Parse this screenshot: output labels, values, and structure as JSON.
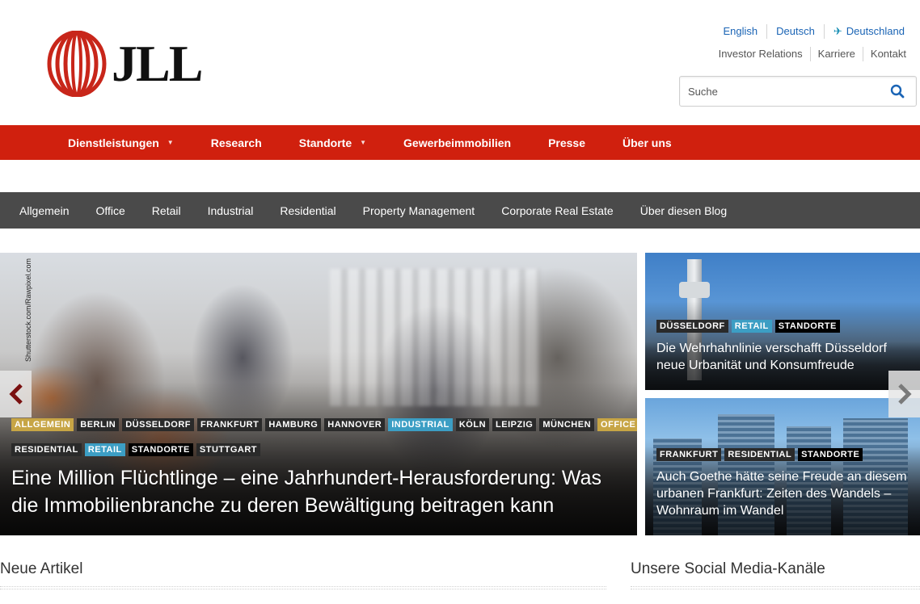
{
  "header": {
    "logo_text": "JLL",
    "languages": [
      "English",
      "Deutsch",
      "Deutschland"
    ],
    "utility_links": [
      "Investor Relations",
      "Karriere",
      "Kontakt"
    ],
    "search_placeholder": "Suche"
  },
  "main_nav": [
    {
      "label": "Dienstleistungen",
      "dropdown": true
    },
    {
      "label": "Research",
      "dropdown": false
    },
    {
      "label": "Standorte",
      "dropdown": true
    },
    {
      "label": "Gewerbeimmobilien",
      "dropdown": false
    },
    {
      "label": "Presse",
      "dropdown": false
    },
    {
      "label": "Über uns",
      "dropdown": false
    }
  ],
  "blog_nav": [
    "Allgemein",
    "Office",
    "Retail",
    "Industrial",
    "Residential",
    "Property Management",
    "Corporate Real Estate",
    "Über diesen Blog"
  ],
  "hero": {
    "photo_credit": "Shutterstock.com/Rawpixel.com",
    "tags_row1": [
      {
        "label": "ALLGEMEIN",
        "style": "gold"
      },
      {
        "label": "BERLIN",
        "style": "dark"
      },
      {
        "label": "DÜSSELDORF",
        "style": "dark"
      },
      {
        "label": "FRANKFURT",
        "style": "dark"
      },
      {
        "label": "HAMBURG",
        "style": "dark"
      },
      {
        "label": "HANNOVER",
        "style": "dark"
      },
      {
        "label": "INDUSTRIAL",
        "style": "blue"
      },
      {
        "label": "KÖLN",
        "style": "dark"
      },
      {
        "label": "LEIPZIG",
        "style": "dark"
      },
      {
        "label": "MÜNCHEN",
        "style": "dark"
      },
      {
        "label": "OFFICE",
        "style": "gold"
      }
    ],
    "tags_row2": [
      {
        "label": "RESIDENTIAL",
        "style": "dark"
      },
      {
        "label": "RETAIL",
        "style": "blue"
      },
      {
        "label": "STANDORTE",
        "style": "black"
      },
      {
        "label": "STUTTGART",
        "style": "dark"
      }
    ],
    "title": "Eine Million Flüchtlinge – eine Jahrhundert-Herausforderung: Was die Immobilienbranche zu deren Bewältigung beitragen kann"
  },
  "cards": [
    {
      "tags": [
        {
          "label": "DÜSSELDORF",
          "style": "dark"
        },
        {
          "label": "RETAIL",
          "style": "blue"
        },
        {
          "label": "STANDORTE",
          "style": "black"
        }
      ],
      "title": "Die Wehrhahnlinie verschafft Düsseldorf neue Urbanität und Konsumfreude"
    },
    {
      "tags": [
        {
          "label": "FRANKFURT",
          "style": "dark"
        },
        {
          "label": "RESIDENTIAL",
          "style": "dark"
        },
        {
          "label": "STANDORTE",
          "style": "black"
        }
      ],
      "title": "Auch Goethe hätte seine Freude an diesem urbanen Frankfurt: Zeiten des Wandels – Wohnraum im Wandel"
    }
  ],
  "sections": {
    "new_articles": "Neue Artikel",
    "social_media": "Unsere Social Media-Kanäle"
  },
  "colors": {
    "brand_red": "#d0200e",
    "blog_nav_bg": "#4a4a4a",
    "link_blue": "#1a64b5",
    "tag_gold": "#c7a545",
    "tag_blue": "#3c9ec4"
  }
}
